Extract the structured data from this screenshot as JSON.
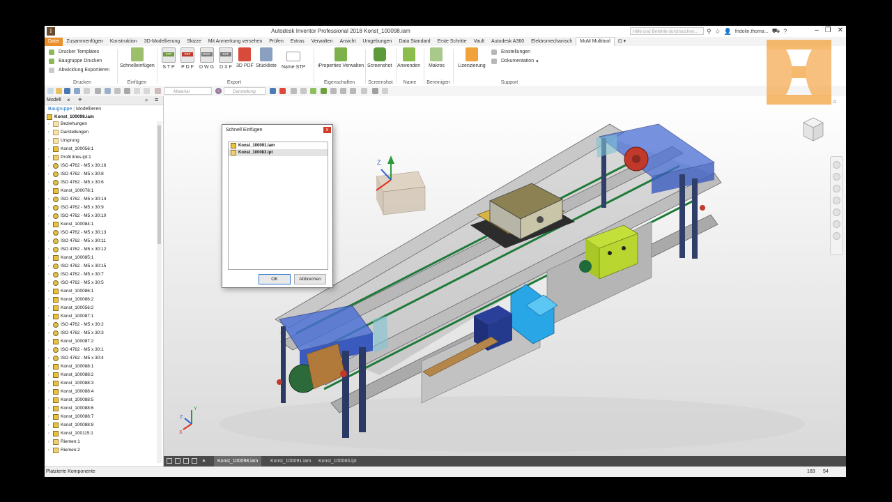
{
  "window": {
    "title": "Autodesk Inventor Professional 2018    Konst_100098.iam",
    "help_placeholder": "Hilfe und Befehle durchsuchen...",
    "user": "fridolin.thoma...",
    "minimize": "–",
    "restore": "❐",
    "close": "✕"
  },
  "ribbon_tabs": [
    "Datei",
    "Zusammenfügen",
    "Konstruktion",
    "3D-Modellierung",
    "Skizze",
    "Mit Anmerkung versehen",
    "Prüfen",
    "Extras",
    "Verwalten",
    "Ansicht",
    "Umgebungen",
    "Data Standard",
    "Erste Schritte",
    "Vault",
    "Autodesk A360",
    "Elektromechanisch",
    "MuM Multitool"
  ],
  "ribbon": {
    "drucken": {
      "title": "Drucken",
      "items": [
        "Drucker Templates",
        "Baugruppe Drucken",
        "Abwicklung Exportieren"
      ]
    },
    "einfuegen": {
      "title": "Einfügen",
      "button": "Schnelleinfügen"
    },
    "export": {
      "title": "Export",
      "buttons": [
        "S T P",
        "P D F",
        "D W G",
        "D X F",
        "3D PDF",
        "Stückliste",
        "Name STP"
      ],
      "tags": [
        "STP",
        "PDF",
        "DWG",
        "DXF"
      ]
    },
    "eigenschaften": {
      "title": "Eigenschaften",
      "button": "iProperties Verwalten"
    },
    "screenshot": {
      "title": "Screenshot",
      "button": "Screenshot"
    },
    "name": {
      "title": "Name",
      "button": "Anwenden"
    },
    "bereinigen": {
      "title": "Bereinigen",
      "button": "Makros"
    },
    "support": {
      "title": "Support",
      "button": "Lizenzierung",
      "items": [
        "Einstellungen",
        "Dokumentation"
      ]
    }
  },
  "qat": {
    "material_placeholder": "Material",
    "appearance_placeholder": "Darstellung"
  },
  "browser": {
    "tab": "Modell",
    "modes": [
      "Baugruppe",
      "Modellieren"
    ],
    "root": "Konst_100098.iam",
    "nodes": [
      {
        "label": "Beziehungen",
        "icon": "folder"
      },
      {
        "label": "Darstellungen",
        "icon": "folder"
      },
      {
        "label": "Ursprung",
        "icon": "folder"
      },
      {
        "label": "Konst_100056:1",
        "icon": "asm"
      },
      {
        "label": "Profil links.ipt:1",
        "icon": "part"
      },
      {
        "label": "ISO 4762 - M5 x 30:16",
        "icon": "screw"
      },
      {
        "label": "ISO 4762 - M5 x 30:8",
        "icon": "screw"
      },
      {
        "label": "ISO 4762 - M5 x 30:6",
        "icon": "screw"
      },
      {
        "label": "Konst_100078:1",
        "icon": "asm"
      },
      {
        "label": "ISO 4762 - M5 x 30:14",
        "icon": "screw"
      },
      {
        "label": "ISO 4762 - M5 x 30:9",
        "icon": "screw"
      },
      {
        "label": "ISO 4762 - M5 x 30:10",
        "icon": "screw"
      },
      {
        "label": "Konst_100084:1",
        "icon": "asm"
      },
      {
        "label": "ISO 4762 - M5 x 30:13",
        "icon": "screw"
      },
      {
        "label": "ISO 4762 - M5 x 30:11",
        "icon": "screw"
      },
      {
        "label": "ISO 4762 - M5 x 30:12",
        "icon": "screw"
      },
      {
        "label": "Konst_100085:1",
        "icon": "asm"
      },
      {
        "label": "ISO 4762 - M5 x 30:15",
        "icon": "screw"
      },
      {
        "label": "ISO 4762 - M5 x 30:7",
        "icon": "screw"
      },
      {
        "label": "ISO 4762 - M5 x 30:5",
        "icon": "screw"
      },
      {
        "label": "Konst_100086:1",
        "icon": "asm"
      },
      {
        "label": "Konst_100086:2",
        "icon": "asm"
      },
      {
        "label": "Konst_100056:2",
        "icon": "asm"
      },
      {
        "label": "Konst_100087:1",
        "icon": "asm"
      },
      {
        "label": "ISO 4762 - M5 x 30:2",
        "icon": "screw"
      },
      {
        "label": "ISO 4762 - M5 x 30:3",
        "icon": "screw"
      },
      {
        "label": "Konst_100087:2",
        "icon": "asm"
      },
      {
        "label": "ISO 4762 - M5 x 30:1",
        "icon": "screw"
      },
      {
        "label": "ISO 4762 - M5 x 30:4",
        "icon": "screw"
      },
      {
        "label": "Konst_100088:1",
        "icon": "asm"
      },
      {
        "label": "Konst_100088:2",
        "icon": "asm"
      },
      {
        "label": "Konst_100088:3",
        "icon": "asm"
      },
      {
        "label": "Konst_100088:4",
        "icon": "asm"
      },
      {
        "label": "Konst_100088:5",
        "icon": "asm"
      },
      {
        "label": "Konst_100088:6",
        "icon": "asm"
      },
      {
        "label": "Konst_100088:7",
        "icon": "asm"
      },
      {
        "label": "Konst_100088:8",
        "icon": "asm"
      },
      {
        "label": "Konst_100115:1",
        "icon": "asm"
      },
      {
        "label": "Riemen:1",
        "icon": "part"
      },
      {
        "label": "Riemen:2",
        "icon": "part"
      }
    ]
  },
  "dialog": {
    "title": "Schnell Einfügen",
    "close": "x",
    "items": [
      "Konst_100091.iam",
      "Konst_100083.ipt"
    ],
    "ok": "OK",
    "cancel": "Abbrechen"
  },
  "doc_tabs": [
    "Konst_100098.iam",
    "Konst_100091.iam",
    "Konst_100083.ipt"
  ],
  "status": {
    "text": "Platzierte Komponente",
    "num1": "169",
    "num2": "54"
  },
  "triad": {
    "x": "X",
    "y": "Y",
    "z": "Z"
  },
  "colors": {
    "file_tab": "#e9902a",
    "logo": "#f4a340",
    "accent": "#2b78d6"
  }
}
